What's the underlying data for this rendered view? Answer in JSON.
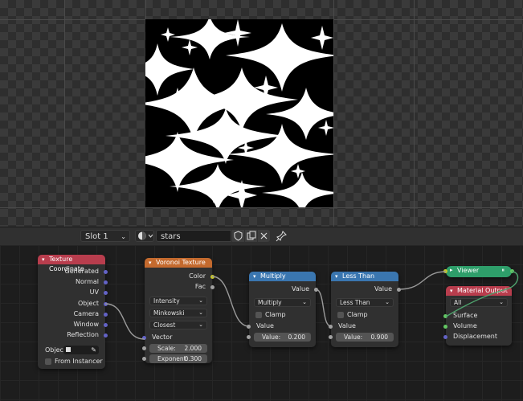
{
  "header": {
    "slot": "Slot 1",
    "material_name": "stars"
  },
  "nodes": {
    "texcoord": {
      "title": "Texture Coordinate",
      "outputs": [
        "Generated",
        "Normal",
        "UV",
        "Object",
        "Camera",
        "Window",
        "Reflection"
      ],
      "object_label": "Objec",
      "from_instancer": "From Instancer"
    },
    "voronoi": {
      "title": "Voronoi Texture",
      "outputs": [
        "Color",
        "Fac"
      ],
      "feature": "Intensity",
      "distance": "Minkowski",
      "mode": "Closest",
      "vector_label": "Vector",
      "scale_label": "Scale:",
      "scale_value": "2.000",
      "exponent_label": "Exponent:",
      "exponent_value": "0.300"
    },
    "multiply": {
      "title": "Multiply",
      "output": "Value",
      "operation": "Multiply",
      "clamp": "Clamp",
      "input_label": "Value",
      "value_label": "Value:",
      "value": "0.200"
    },
    "lessthan": {
      "title": "Less Than",
      "output": "Value",
      "operation": "Less Than",
      "clamp": "Clamp",
      "input_label": "Value",
      "value_label": "Value:",
      "value": "0.900"
    },
    "viewer": {
      "title": "Viewer"
    },
    "matout": {
      "title": "Material Output",
      "target": "All",
      "inputs": [
        "Surface",
        "Volume",
        "Displacement"
      ]
    }
  },
  "colors": {
    "input_header": "#b83d4d",
    "texture_header": "#c46a2e",
    "converter_header": "#3a76b0",
    "output_header": "#b83d4d",
    "viewer_header": "#2e9e6a"
  }
}
